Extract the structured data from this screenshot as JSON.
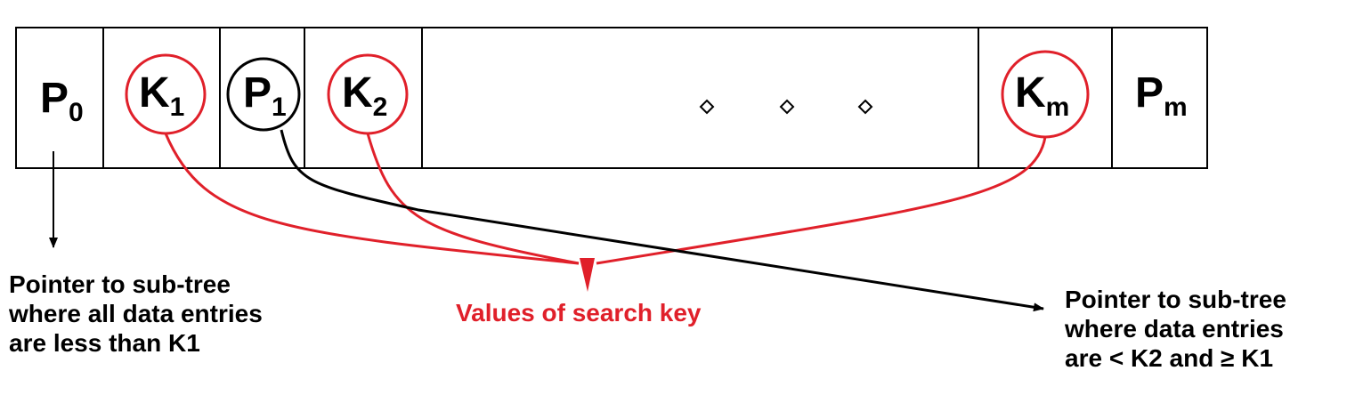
{
  "node": {
    "cells": [
      {
        "id": "P0",
        "main": "P",
        "sub": "0"
      },
      {
        "id": "K1",
        "main": "K",
        "sub": "1"
      },
      {
        "id": "P1",
        "main": "P",
        "sub": "1"
      },
      {
        "id": "K2",
        "main": "K",
        "sub": "2"
      },
      {
        "id": "ellipsis",
        "main": "",
        "sub": ""
      },
      {
        "id": "Km",
        "main": "K",
        "sub": "m"
      },
      {
        "id": "Pm",
        "main": "P",
        "sub": "m"
      }
    ]
  },
  "notes": {
    "left": [
      "Pointer to sub-tree",
      "where all data entries",
      "are less than K1"
    ],
    "center": "Values of search key",
    "right": [
      "Pointer to sub-tree",
      "where data entries",
      "are < K2 and ≥ K1"
    ]
  },
  "colors": {
    "key_circle": "#e0202a",
    "pointer_circle": "#000000",
    "key_label": "#e0202a",
    "outline": "#000000"
  }
}
